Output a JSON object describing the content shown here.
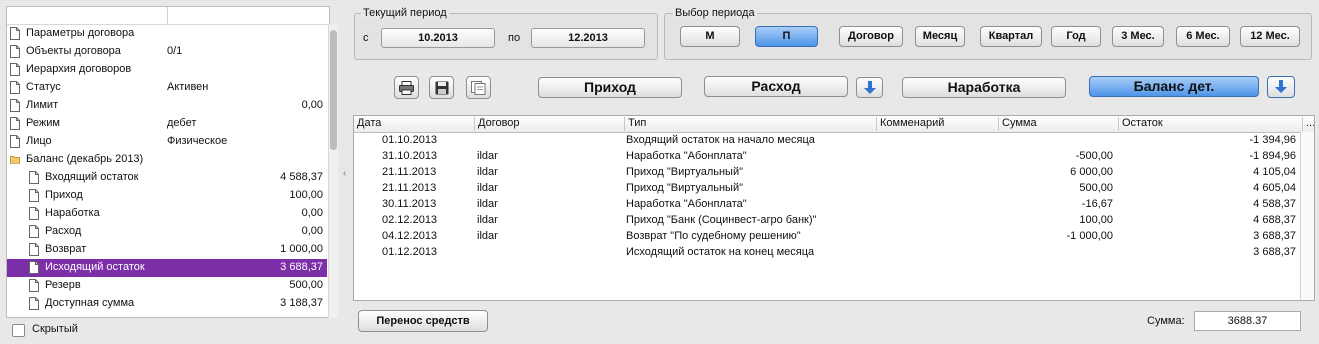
{
  "tree": {
    "items": [
      {
        "label": "Параметры договора",
        "value": "",
        "icon": "document-icon",
        "level": 0
      },
      {
        "label": "Объекты договора",
        "value": "0/1",
        "icon": "document-icon",
        "level": 0
      },
      {
        "label": "Иерархия договоров",
        "value": "",
        "icon": "document-icon",
        "level": 0
      },
      {
        "label": "Статус",
        "value": "Активен",
        "icon": "document-icon",
        "level": 0
      },
      {
        "label": "Лимит",
        "value": "0,00",
        "icon": "document-icon",
        "level": 0,
        "align": "right"
      },
      {
        "label": "Режим",
        "value": "дебет",
        "icon": "document-icon",
        "level": 0
      },
      {
        "label": "Лицо",
        "value": "Физическое",
        "icon": "document-icon",
        "level": 0
      },
      {
        "label": "Баланс (декабрь 2013)",
        "value": "",
        "icon": "folder-icon",
        "level": 0
      },
      {
        "label": "Входящий остаток",
        "value": "4 588,37",
        "icon": "document-icon",
        "level": 1,
        "align": "right"
      },
      {
        "label": "Приход",
        "value": "100,00",
        "icon": "document-icon",
        "level": 1,
        "align": "right"
      },
      {
        "label": "Наработка",
        "value": "0,00",
        "icon": "document-icon",
        "level": 1,
        "align": "right"
      },
      {
        "label": "Расход",
        "value": "0,00",
        "icon": "document-icon",
        "level": 1,
        "align": "right"
      },
      {
        "label": "Возврат",
        "value": "1 000,00",
        "icon": "document-icon",
        "level": 1,
        "align": "right"
      },
      {
        "label": "Исходящий остаток",
        "value": "3 688,37",
        "icon": "document-icon",
        "level": 1,
        "align": "right",
        "selected": true
      },
      {
        "label": "Резерв",
        "value": "500,00",
        "icon": "document-icon",
        "level": 1,
        "align": "right"
      },
      {
        "label": "Доступная сумма",
        "value": "3 188,37",
        "icon": "document-icon",
        "level": 1,
        "align": "right"
      }
    ],
    "hidden_label": "Скрытый"
  },
  "current_period": {
    "title": "Текущий период",
    "from_label": "с",
    "from_value": "10.2013",
    "to_label": "по",
    "to_value": "12.2013"
  },
  "period_select": {
    "title": "Выбор периода",
    "buttons": [
      "М",
      "П",
      "Договор",
      "Месяц",
      "Квартал",
      "Год",
      "3 Мес.",
      "6 Мес.",
      "12 Мес."
    ],
    "active": "П"
  },
  "toolbar": {
    "icons": [
      "printer-icon",
      "save-icon",
      "copy-icon"
    ],
    "income": "Приход",
    "expense": "Расход",
    "accrual": "Наработка",
    "balance": "Баланс дет."
  },
  "table": {
    "columns": [
      "Дата",
      "Договор",
      "Тип",
      "Комменарий",
      "Сумма",
      "Остаток"
    ],
    "more": "...",
    "rows": [
      {
        "date": "01.10.2013",
        "contract": "",
        "type": "Входящий остаток на начало месяца",
        "comment": "",
        "sum": "",
        "balance": "-1 394,96"
      },
      {
        "date": "31.10.2013",
        "contract": "ildar",
        "type": "Наработка \"Абонплата\"",
        "comment": "",
        "sum": "-500,00",
        "balance": "-1 894,96"
      },
      {
        "date": "21.11.2013",
        "contract": "ildar",
        "type": "Приход \"Виртуальный\"",
        "comment": "",
        "sum": "6 000,00",
        "balance": "4 105,04"
      },
      {
        "date": "21.11.2013",
        "contract": "ildar",
        "type": "Приход \"Виртуальный\"",
        "comment": "",
        "sum": "500,00",
        "balance": "4 605,04"
      },
      {
        "date": "30.11.2013",
        "contract": "ildar",
        "type": "Наработка \"Абонплата\"",
        "comment": "",
        "sum": "-16,67",
        "balance": "4 588,37"
      },
      {
        "date": "02.12.2013",
        "contract": "ildar",
        "type": "Приход \"Банк (Социнвест-агро банк)\"",
        "comment": "",
        "sum": "100,00",
        "balance": "4 688,37"
      },
      {
        "date": "04.12.2013",
        "contract": "ildar",
        "type": "Возврат \"По судебному решению\"",
        "comment": "",
        "sum": "-1 000,00",
        "balance": "3 688,37"
      },
      {
        "date": "01.12.2013",
        "contract": "",
        "type": "Исходящий остаток на конец месяца",
        "comment": "",
        "sum": "",
        "balance": "3 688,37"
      }
    ]
  },
  "footer": {
    "transfer": "Перенос средств",
    "sum_label": "Сумма:",
    "sum_value": "3688.37"
  },
  "colors": {
    "selection": "#7c2fa8",
    "accent_blue": "#4e95e8"
  }
}
